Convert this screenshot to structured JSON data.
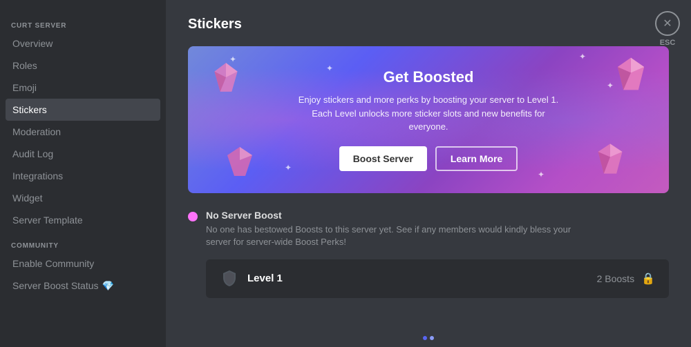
{
  "sidebar": {
    "server_section_label": "CURT SERVER",
    "items": [
      {
        "id": "overview",
        "label": "Overview",
        "active": false
      },
      {
        "id": "roles",
        "label": "Roles",
        "active": false
      },
      {
        "id": "emoji",
        "label": "Emoji",
        "active": false
      },
      {
        "id": "stickers",
        "label": "Stickers",
        "active": true
      },
      {
        "id": "moderation",
        "label": "Moderation",
        "active": false
      },
      {
        "id": "audit-log",
        "label": "Audit Log",
        "active": false
      },
      {
        "id": "integrations",
        "label": "Integrations",
        "active": false
      },
      {
        "id": "widget",
        "label": "Widget",
        "active": false
      },
      {
        "id": "server-template",
        "label": "Server Template",
        "active": false
      }
    ],
    "community_section_label": "COMMUNITY",
    "community_items": [
      {
        "id": "enable-community",
        "label": "Enable Community",
        "active": false
      },
      {
        "id": "server-boost-status",
        "label": "Server Boost Status",
        "active": false,
        "has_icon": true
      }
    ]
  },
  "main": {
    "page_title": "Stickers",
    "esc_label": "ESC",
    "banner": {
      "title": "Get Boosted",
      "description": "Enjoy stickers and more perks by boosting your server to Level 1. Each Level unlocks more sticker slots and new benefits for everyone.",
      "boost_button": "Boost Server",
      "learn_button": "Learn More"
    },
    "no_boost": {
      "title": "No Server Boost",
      "description": "No one has bestowed Boosts to this server yet. See if any members would kindly bless your server for server-wide Boost Perks!"
    },
    "level_card": {
      "label": "Level 1",
      "boosts": "2 Boosts"
    }
  }
}
